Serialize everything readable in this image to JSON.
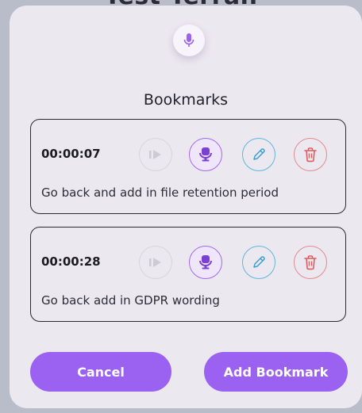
{
  "backdrop": {
    "title_partial": "Test Terran"
  },
  "dialog": {
    "title": "Bookmarks",
    "bookmarks": [
      {
        "time": "00:00:07",
        "note": "Go back and add in file retention period"
      },
      {
        "time": "00:00:28",
        "note": "Go back add in GDPR wording"
      }
    ],
    "cancel_label": "Cancel",
    "add_label": "Add Bookmark"
  },
  "icons": {
    "header": "microphone-icon",
    "play": "play-icon",
    "record": "microphone-icon",
    "edit": "pencil-icon",
    "delete": "trash-icon"
  },
  "colors": {
    "accent": "#9b61f1",
    "record": "#7c3fd6",
    "edit": "#3a9fcf",
    "delete": "#e05c5c",
    "disabled": "#c9c6cf"
  }
}
